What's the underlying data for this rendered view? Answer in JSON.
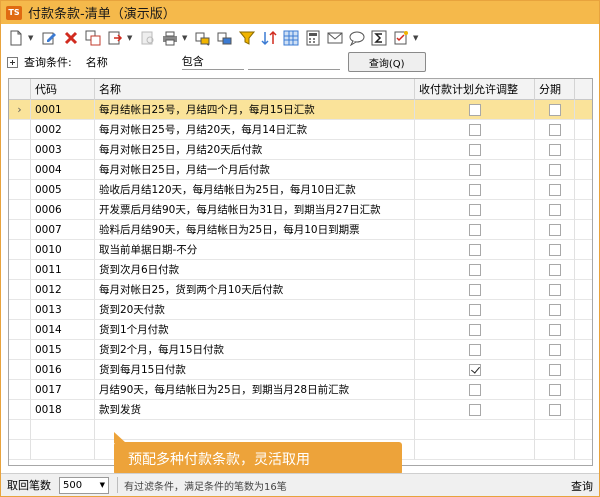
{
  "window": {
    "title": "付款条款-清单（演示版）",
    "app_icon_text": "TS"
  },
  "toolbar": {
    "icons": [
      "new-document-icon",
      "edit-icon",
      "delete-icon",
      "copy-icon",
      "export-icon",
      "print-preview-icon",
      "print-icon",
      "link-icon",
      "link-alt-icon",
      "filter-icon",
      "sort-icon",
      "grid-icon",
      "calculator-icon",
      "mail-icon",
      "chat-icon",
      "sum-icon",
      "checklist-icon"
    ]
  },
  "query": {
    "label": "查询条件:",
    "field": "名称",
    "operator": "包含",
    "value": "",
    "button": "查询(Q)"
  },
  "grid": {
    "columns": [
      "代码",
      "名称",
      "收付款计划允许调整",
      "分期"
    ],
    "rows": [
      {
        "code": "0001",
        "name": "每月结帐日25号，月结四个月，每月15日汇款",
        "flag": false,
        "inst": false
      },
      {
        "code": "0002",
        "name": "每月对帐日25号，月结20天，每月14日汇款",
        "flag": false,
        "inst": false
      },
      {
        "code": "0003",
        "name": "每月对帐日25日，月结20天后付款",
        "flag": false,
        "inst": false
      },
      {
        "code": "0004",
        "name": "每月对帐日25日，月结一个月后付款",
        "flag": false,
        "inst": false
      },
      {
        "code": "0005",
        "name": "验收后月结120天，每月结帐日为25日，每月10日汇款",
        "flag": false,
        "inst": false
      },
      {
        "code": "0006",
        "name": "开发票后月结90天，每月结帐日为31日，到期当月27日汇款",
        "flag": false,
        "inst": false
      },
      {
        "code": "0007",
        "name": "验料后月结90天，每月结帐日为25日，每月10日到期票",
        "flag": false,
        "inst": false
      },
      {
        "code": "0010",
        "name": "取当前单据日期-不分",
        "flag": false,
        "inst": false
      },
      {
        "code": "0011",
        "name": "货到次月6日付款",
        "flag": false,
        "inst": false
      },
      {
        "code": "0012",
        "name": "每月对帐日25，货到两个月10天后付款",
        "flag": false,
        "inst": false
      },
      {
        "code": "0013",
        "name": "货到20天付款",
        "flag": false,
        "inst": false
      },
      {
        "code": "0014",
        "name": "货到1个月付款",
        "flag": false,
        "inst": false
      },
      {
        "code": "0015",
        "name": "货到2个月，每月15日付款",
        "flag": false,
        "inst": false
      },
      {
        "code": "0016",
        "name": "货到每月15日付款",
        "flag": true,
        "inst": false
      },
      {
        "code": "0017",
        "name": "月结90天，每月结帐日为25日，到期当月28日前汇款",
        "flag": false,
        "inst": false
      },
      {
        "code": "0018",
        "name": "款到发货",
        "flag": false,
        "inst": false
      }
    ],
    "selected_row_marker": "›"
  },
  "banner": {
    "text": "预配多种付款条款，灵活取用"
  },
  "statusbar": {
    "fetch_label": "取回笔数",
    "fetch_value": "500",
    "status_text": "有过滤条件，满足条件的笔数为16笔",
    "right_text": "查询"
  },
  "colors": {
    "title_bg": "#f5b94b",
    "selected_row": "#fae39a",
    "banner": "#eda33a"
  }
}
